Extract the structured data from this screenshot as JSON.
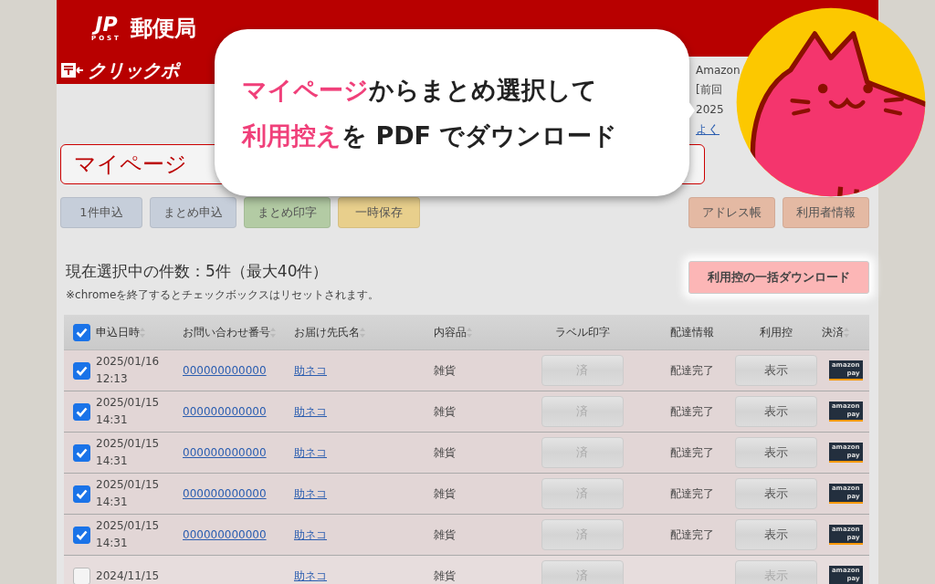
{
  "header": {
    "logo_mark": "JP",
    "logo_sub": "POST",
    "logo_text": "郵便局",
    "service_logo": "クリックポ",
    "account_lines": [
      "Amazon",
      "[前回",
      "2025"
    ],
    "help_link": "よく"
  },
  "page_title": "マイページ",
  "nav_buttons": [
    {
      "label": "1件申込",
      "color": "#c6ceda"
    },
    {
      "label": "まとめ申込",
      "color": "#c6ceda"
    },
    {
      "label": "まとめ印字",
      "color": "#b3cba4"
    },
    {
      "label": "一時保存",
      "color": "#e8cf8c"
    }
  ],
  "side_buttons": [
    {
      "label": "アドレス帳",
      "color": "#e4b9a3"
    },
    {
      "label": "利用者情報",
      "color": "#e4b9a3"
    }
  ],
  "selection": {
    "count_text": "現在選択中の件数：5件（最大40件）",
    "note": "※chromeを終了するとチェックボックスはリセットされます。"
  },
  "download_button": "利用控の一括ダウンロード",
  "table": {
    "select_all": {
      "checked": true
    },
    "columns": [
      {
        "label": "申込日時",
        "sortable": true
      },
      {
        "label": "お問い合わせ番号",
        "sortable": true
      },
      {
        "label": "お届け先氏名",
        "sortable": true
      },
      {
        "label": "内容品",
        "sortable": true
      },
      {
        "label": "ラベル印字",
        "sortable": false
      },
      {
        "label": "配達情報",
        "sortable": false
      },
      {
        "label": "利用控",
        "sortable": false
      },
      {
        "label": "決済",
        "sortable": true
      }
    ],
    "rows": [
      {
        "checked": true,
        "date": "2025/01/16",
        "time": "12:13",
        "tracking": "000000000000",
        "name": "助ネコ",
        "contents": "雑貨",
        "label_button": {
          "label": "済",
          "disabled": true
        },
        "delivery": "配達完了",
        "receipt_button": {
          "label": "表示",
          "disabled": false
        },
        "payment": [
          "amazon",
          "pay"
        ]
      },
      {
        "checked": true,
        "date": "2025/01/15",
        "time": "14:31",
        "tracking": "000000000000",
        "name": "助ネコ",
        "contents": "雑貨",
        "label_button": {
          "label": "済",
          "disabled": true
        },
        "delivery": "配達完了",
        "receipt_button": {
          "label": "表示",
          "disabled": false
        },
        "payment": [
          "amazon",
          "pay"
        ]
      },
      {
        "checked": true,
        "date": "2025/01/15",
        "time": "14:31",
        "tracking": "000000000000",
        "name": "助ネコ",
        "contents": "雑貨",
        "label_button": {
          "label": "済",
          "disabled": true
        },
        "delivery": "配達完了",
        "receipt_button": {
          "label": "表示",
          "disabled": false
        },
        "payment": [
          "amazon",
          "pay"
        ]
      },
      {
        "checked": true,
        "date": "2025/01/15",
        "time": "14:31",
        "tracking": "000000000000",
        "name": "助ネコ",
        "contents": "雑貨",
        "label_button": {
          "label": "済",
          "disabled": true
        },
        "delivery": "配達完了",
        "receipt_button": {
          "label": "表示",
          "disabled": false
        },
        "payment": [
          "amazon",
          "pay"
        ]
      },
      {
        "checked": true,
        "date": "2025/01/15",
        "time": "14:31",
        "tracking": "000000000000",
        "name": "助ネコ",
        "contents": "雑貨",
        "label_button": {
          "label": "済",
          "disabled": true
        },
        "delivery": "配達完了",
        "receipt_button": {
          "label": "表示",
          "disabled": false
        },
        "payment": [
          "amazon",
          "pay"
        ]
      },
      {
        "checked": false,
        "date": "2024/11/15",
        "name": "助ネコ",
        "contents": "雑貨",
        "label_button": {
          "label": "済",
          "disabled": true
        },
        "receipt_button": {
          "label": "表示",
          "disabled": true
        },
        "payment": [
          "amazon",
          "pay"
        ]
      }
    ]
  },
  "callout": {
    "lines": [
      [
        {
          "text": "マイページ",
          "highlight": true
        },
        {
          "text": "からまとめ選択して",
          "highlight": false
        }
      ],
      [
        {
          "text": "利用控え",
          "highlight": true
        },
        {
          "text": "を PDF でダウンロード",
          "highlight": false
        }
      ]
    ]
  }
}
